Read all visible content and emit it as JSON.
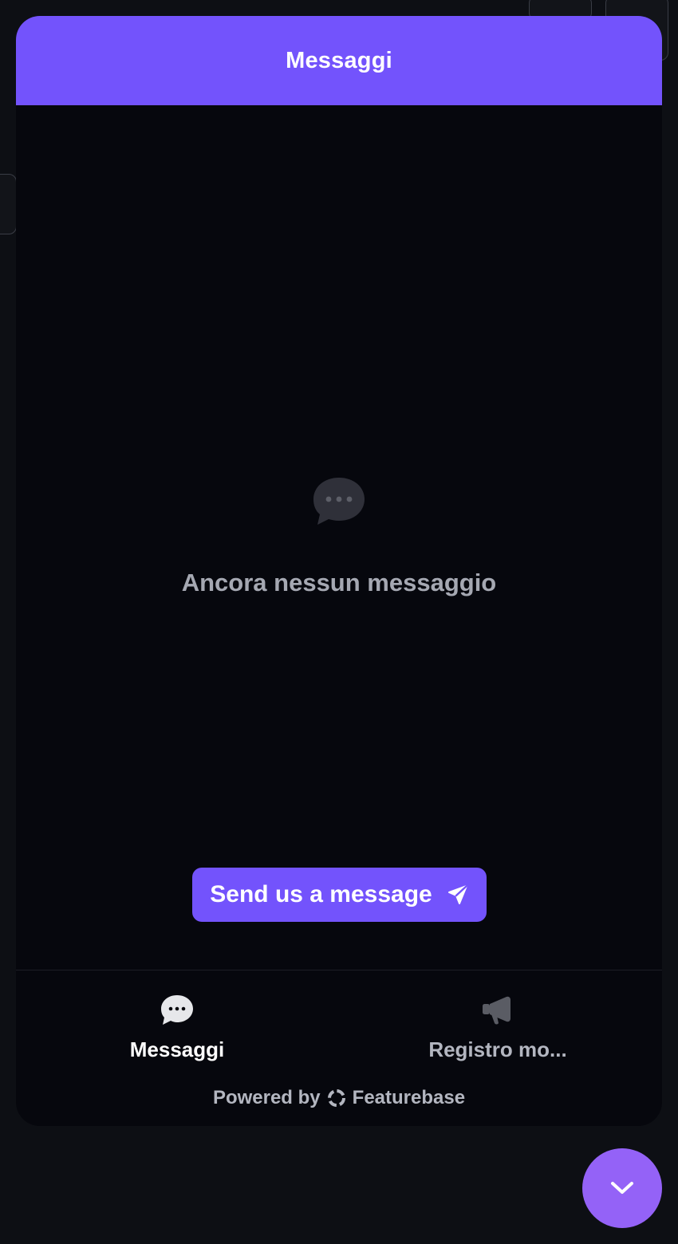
{
  "header": {
    "title": "Messaggi"
  },
  "empty_state": {
    "icon": "chat-bubble-icon",
    "text": "Ancora nessun messaggio"
  },
  "send_button": {
    "label": "Send us a message",
    "icon": "paper-plane-icon"
  },
  "tabs": [
    {
      "label": "Messaggi",
      "icon": "chat-bubble-icon",
      "active": true
    },
    {
      "label": "Registro mo...",
      "icon": "megaphone-icon",
      "active": false
    }
  ],
  "footer": {
    "powered_by": "Powered by",
    "brand": "Featurebase",
    "brand_icon": "featurebase-logo-icon"
  },
  "launcher": {
    "icon": "chevron-down-icon"
  },
  "colors": {
    "accent": "#7353fc",
    "launcher": "#9462f7",
    "panel_bg": "#06070d",
    "page_bg": "#0d0f14",
    "muted_text": "#a5a8b2"
  }
}
